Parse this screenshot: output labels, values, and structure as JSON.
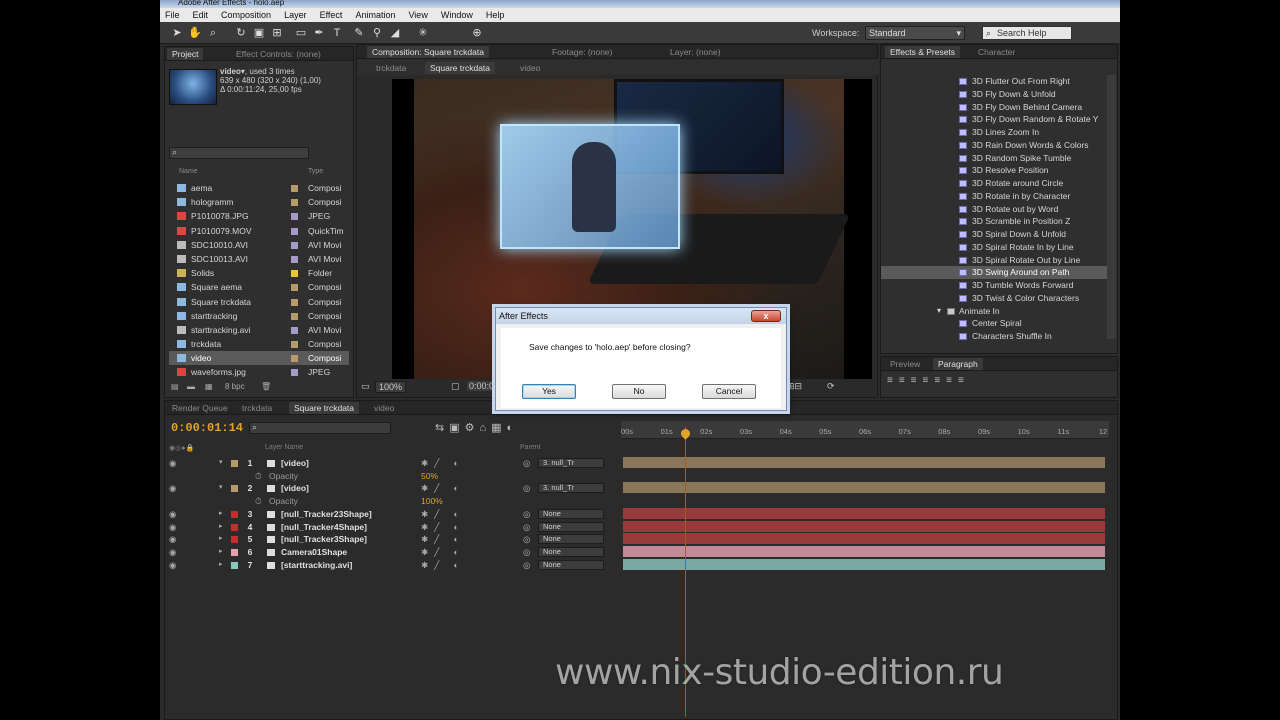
{
  "app": {
    "title": "Adobe After Effects - holo.aep"
  },
  "menu": [
    "File",
    "Edit",
    "Composition",
    "Layer",
    "Effect",
    "Animation",
    "View",
    "Window",
    "Help"
  ],
  "toolbar": {
    "workspace_label": "Workspace:",
    "workspace_value": "Standard",
    "search_placeholder": "Search Help"
  },
  "project": {
    "tabs": [
      "Project",
      "Effect Controls: (none)"
    ],
    "selected_item": {
      "name": "video▾",
      "used": ", used 3 times",
      "dims": "639 x 480  (320 x 240) (1,00)",
      "duration": "Δ 0:00:11:24, 25,00 fps"
    },
    "col_name": "Name",
    "col_type": "Type",
    "items": [
      {
        "name": "aema",
        "type": "Composi",
        "icon": "comp",
        "label": "#b59a6a"
      },
      {
        "name": "hologramm",
        "type": "Composi",
        "icon": "comp",
        "label": "#b59a6a"
      },
      {
        "name": "P1010078.JPG",
        "type": "JPEG",
        "icon": "image",
        "label": "#a79ac9"
      },
      {
        "name": "P1010079.MOV",
        "type": "QuickTim",
        "icon": "image",
        "label": "#a79ac9"
      },
      {
        "name": "SDC10010.AVI",
        "type": "AVI Movi",
        "icon": "footage",
        "label": "#a79ac9"
      },
      {
        "name": "SDC10013.AVI",
        "type": "AVI Movi",
        "icon": "footage",
        "label": "#a79ac9"
      },
      {
        "name": "Solids",
        "type": "Folder",
        "icon": "folder",
        "label": "#e8c83a"
      },
      {
        "name": "Square aema",
        "type": "Composi",
        "icon": "comp",
        "label": "#b59a6a"
      },
      {
        "name": "Square trckdata",
        "type": "Composi",
        "icon": "comp",
        "label": "#b59a6a"
      },
      {
        "name": "starttracking",
        "type": "Composi",
        "icon": "comp",
        "label": "#b59a6a"
      },
      {
        "name": "starttracking.avi",
        "type": "AVI Movi",
        "icon": "footage",
        "label": "#a79ac9"
      },
      {
        "name": "trckdata",
        "type": "Composi",
        "icon": "comp",
        "label": "#b59a6a"
      },
      {
        "name": "video",
        "type": "Composi",
        "icon": "comp",
        "label": "#b59a6a",
        "selected": true
      },
      {
        "name": "waveforms.jpg",
        "type": "JPEG",
        "icon": "image",
        "label": "#a79ac9"
      }
    ],
    "bpc": "8 bpc"
  },
  "composition": {
    "tabs": [
      "Composition: Square trckdata",
      "Footage: (none)",
      "Layer: (none)"
    ],
    "breadcrumbs": [
      "trckdata",
      "Square trckdata",
      "video"
    ],
    "zoom": "100%",
    "time": "0:00:0"
  },
  "effects": {
    "tabs": [
      "Effects & Presets",
      "Character"
    ],
    "items": [
      {
        "name": "3D Flutter Out From Right"
      },
      {
        "name": "3D Fly Down & Unfold"
      },
      {
        "name": "3D Fly Down Behind Camera"
      },
      {
        "name": "3D Fly Down Random & Rotate Y"
      },
      {
        "name": "3D Lines Zoom In"
      },
      {
        "name": "3D Rain Down Words & Colors"
      },
      {
        "name": "3D Random Spike Tumble"
      },
      {
        "name": "3D Resolve Position"
      },
      {
        "name": "3D Rotate around Circle"
      },
      {
        "name": "3D Rotate in by Character"
      },
      {
        "name": "3D Rotate out by Word"
      },
      {
        "name": "3D Scramble in Position Z"
      },
      {
        "name": "3D Spiral Down & Unfold"
      },
      {
        "name": "3D Spiral Rotate In by Line"
      },
      {
        "name": "3D Spiral Rotate Out by Line"
      },
      {
        "name": "3D Swing Around on Path",
        "selected": true
      },
      {
        "name": "3D Tumble Words Forward"
      },
      {
        "name": "3D Twist & Color Characters"
      },
      {
        "name": "Animate In",
        "folder": true
      },
      {
        "name": "Center Spiral"
      },
      {
        "name": "Characters Shuffle In"
      }
    ]
  },
  "paragraph": {
    "tabs": [
      "Preview",
      "Paragraph"
    ]
  },
  "timeline": {
    "tabs": [
      "Render Queue",
      "trckdata",
      "Square trckdata",
      "video"
    ],
    "current_time": "0:00:01:14",
    "col_layer": "Layer Name",
    "col_parent": "Parent",
    "ruler": [
      "00s",
      "01s",
      "02s",
      "03s",
      "04s",
      "05s",
      "06s",
      "07s",
      "08s",
      "09s",
      "10s",
      "11s",
      "12"
    ],
    "layers": [
      {
        "num": "1",
        "name": "[video]",
        "label": "#b59a6a",
        "parent": "3. null_Tr",
        "bar": "#8a7658"
      },
      {
        "sub": true,
        "name": "Opacity",
        "value": "50%"
      },
      {
        "num": "2",
        "name": "[video]",
        "label": "#b59a6a",
        "parent": "3. null_Tr",
        "bar": "#8a7658"
      },
      {
        "sub": true,
        "name": "Opacity",
        "value": "100%"
      },
      {
        "num": "3",
        "name": "[null_Tracker23Shape]",
        "label": "#c03030",
        "parent": "None",
        "bar": "#9a3a3c"
      },
      {
        "num": "4",
        "name": "[null_Tracker4Shape]",
        "label": "#c03030",
        "parent": "None",
        "bar": "#9a3a3c"
      },
      {
        "num": "5",
        "name": "[null_Tracker3Shape]",
        "label": "#c03030",
        "parent": "None",
        "bar": "#9a3a3c"
      },
      {
        "num": "6",
        "name": "Camera01Shape",
        "label": "#e3a0b0",
        "parent": "None",
        "bar": "#c48a98"
      },
      {
        "num": "7",
        "name": "[starttracking.avi]",
        "label": "#8cc8c0",
        "parent": "None",
        "bar": "#7aa8a4"
      }
    ]
  },
  "dialog": {
    "title": "After Effects",
    "message": "Save changes to 'holo.aep' before closing?",
    "yes": "Yes",
    "no": "No",
    "cancel": "Cancel"
  },
  "watermark": "www.nix-studio-edition.ru"
}
